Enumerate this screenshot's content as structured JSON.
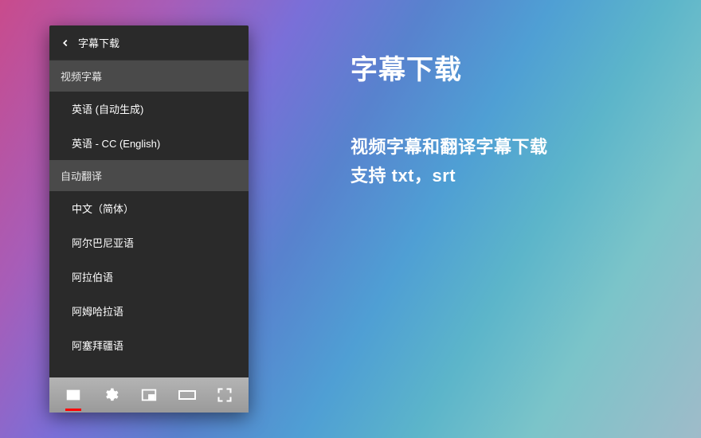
{
  "panel": {
    "title": "字幕下载",
    "sections": [
      {
        "label": "视频字幕",
        "items": [
          "英语 (自动生成)",
          "英语 - CC (English)"
        ]
      },
      {
        "label": "自动翻译",
        "items": [
          "中文（简体）",
          "阿尔巴尼亚语",
          "阿拉伯语",
          "阿姆哈拉语",
          "阿塞拜疆语"
        ]
      }
    ]
  },
  "controls": {
    "subtitles": "subtitles-icon",
    "settings": "settings-icon",
    "miniplayer": "miniplayer-icon",
    "theater": "theater-icon",
    "fullscreen": "fullscreen-icon"
  },
  "promo": {
    "title": "字幕下载",
    "line1": "视频字幕和翻译字幕下载",
    "line2": "支持 txt，srt"
  }
}
